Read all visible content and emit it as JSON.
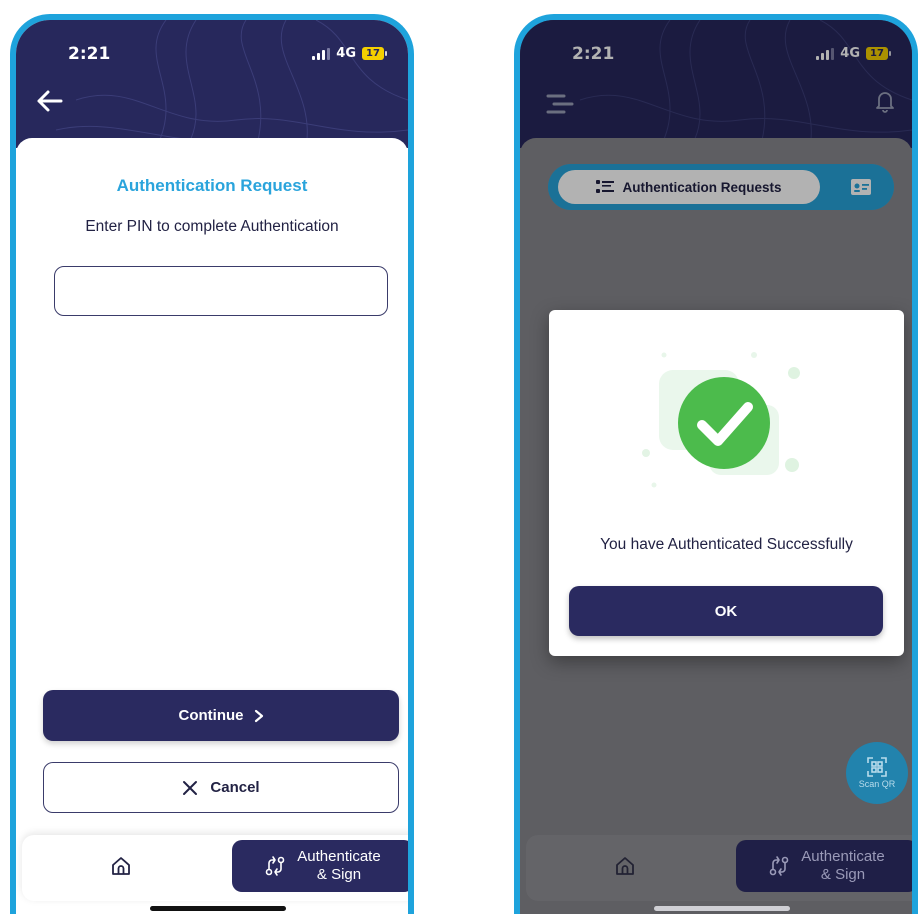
{
  "status_bar": {
    "time": "2:21",
    "network": "4G",
    "battery": "17"
  },
  "auth_screen": {
    "title": "Authentication Request",
    "subtitle": "Enter PIN to complete Authentication",
    "pin_value": "",
    "continue_label": "Continue",
    "cancel_label": "Cancel"
  },
  "bottom_nav": {
    "auth_label_line1": "Authenticate",
    "auth_label_line2": "& Sign"
  },
  "home_screen": {
    "tab_label": "Authentication Requests",
    "dialog_message": "You have Authenticated Successfully",
    "ok_label": "OK",
    "scan_qr_label": "Scan QR"
  },
  "colors": {
    "brand_navy": "#2a2a60",
    "accent_blue": "#2aa4dc",
    "success_green": "#4cbb4c"
  }
}
